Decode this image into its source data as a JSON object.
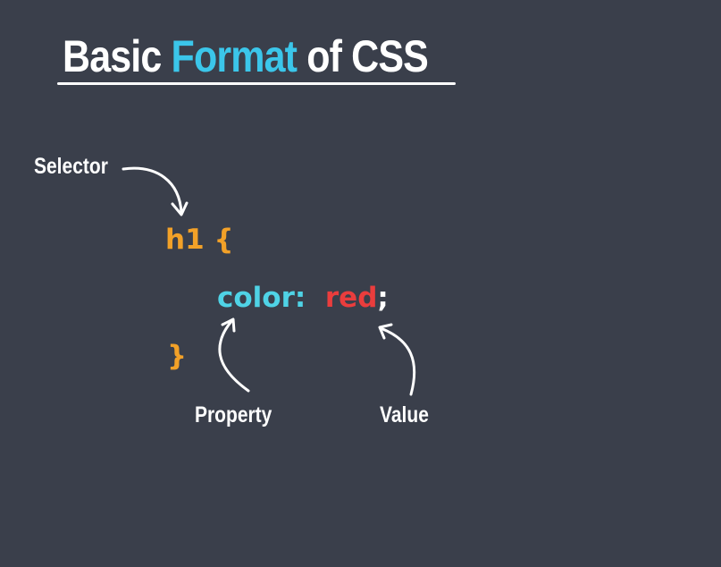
{
  "title": {
    "part1": "Basic ",
    "accent": "Format",
    "part2": " of CSS"
  },
  "labels": {
    "selector": "Selector",
    "property": "Property",
    "value": "Value"
  },
  "code": {
    "selector": "h1",
    "open_brace": "{",
    "property": "color:",
    "value": "red",
    "semicolon": ";",
    "close_brace": "}"
  },
  "colors": {
    "background": "#3a3f4b",
    "accent": "#3bc6ea",
    "selector": "#f2a128",
    "property": "#4fd3e6",
    "value": "#ea3d3d"
  }
}
